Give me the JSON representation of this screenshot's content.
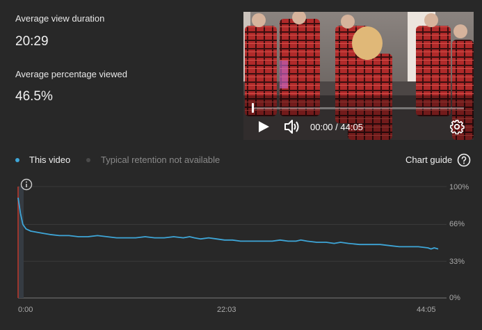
{
  "stats": {
    "avg_view_duration_label": "Average view duration",
    "avg_view_duration_value": "20:29",
    "avg_percentage_viewed_label": "Average percentage viewed",
    "avg_percentage_viewed_value": "46.5%"
  },
  "player": {
    "time_display": "00:00 / 44:05",
    "progress_fraction": 0,
    "icons": [
      "play-icon",
      "volume-icon",
      "settings-icon"
    ]
  },
  "legend": {
    "this_video": "This video",
    "typical": "Typical retention not available"
  },
  "chart_guide": {
    "label": "Chart guide",
    "icon": "help-circle-icon"
  },
  "colors": {
    "background": "#282828",
    "series": "#3ea6d8",
    "marker": "#c0392b"
  },
  "chart_data": {
    "type": "line",
    "x_ticks": [
      "0:00",
      "22:03",
      "44:05"
    ],
    "y_ticks": [
      "100%",
      "66%",
      "33%",
      "0%"
    ],
    "ylim": [
      0,
      100
    ],
    "xlim": [
      0,
      2645
    ],
    "grid": true,
    "series": [
      {
        "name": "This video",
        "x": [
          0,
          15,
          30,
          50,
          80,
          120,
          160,
          200,
          260,
          320,
          380,
          440,
          500,
          560,
          620,
          680,
          740,
          800,
          860,
          920,
          980,
          1040,
          1080,
          1110,
          1150,
          1200,
          1250,
          1300,
          1350,
          1400,
          1450,
          1500,
          1550,
          1600,
          1650,
          1700,
          1750,
          1780,
          1820,
          1880,
          1940,
          1990,
          2030,
          2080,
          2150,
          2220,
          2280,
          2340,
          2400,
          2460,
          2520,
          2580,
          2600,
          2620,
          2645
        ],
        "values": [
          90,
          76,
          66,
          62,
          60,
          59,
          58,
          57,
          56,
          56,
          55,
          55,
          56,
          55,
          54,
          54,
          54,
          55,
          54,
          54,
          55,
          54,
          55,
          54,
          53,
          54,
          53,
          52,
          52,
          51,
          51,
          51,
          51,
          51,
          52,
          51,
          51,
          52,
          51,
          50,
          50,
          49,
          50,
          49,
          48,
          48,
          48,
          47,
          46,
          46,
          46,
          45,
          44,
          45,
          44
        ]
      }
    ]
  }
}
